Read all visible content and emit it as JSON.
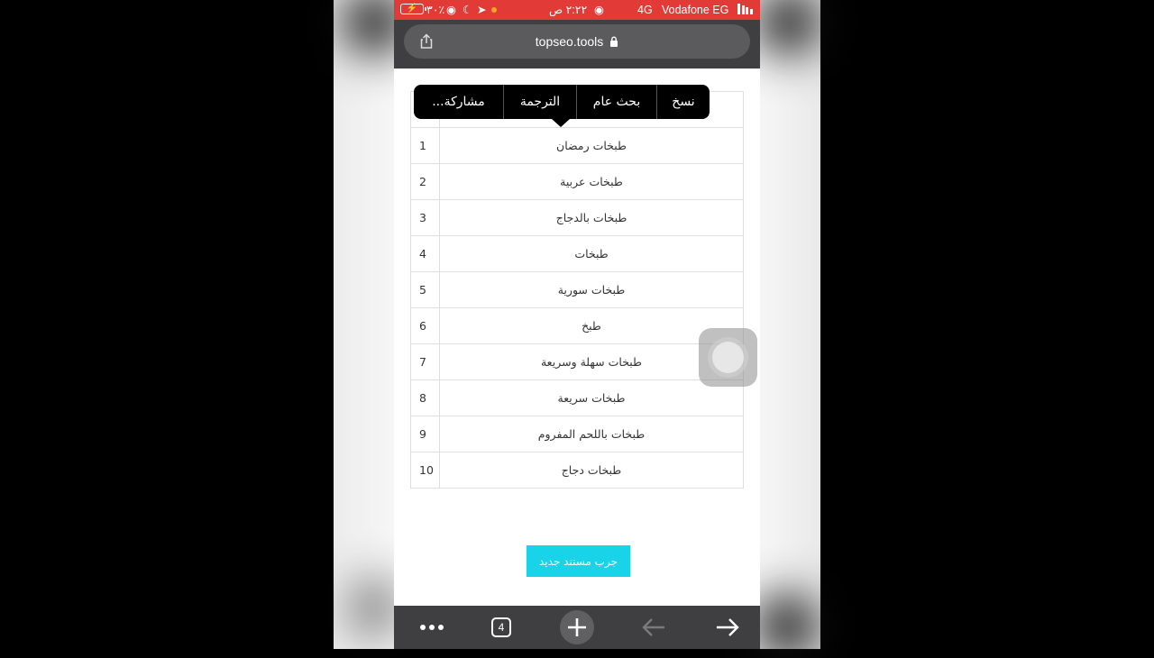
{
  "status_bar": {
    "carrier": "Vodafone EG",
    "network": "4G",
    "time": "٢:٢٢ ص",
    "battery": "٣٠٪"
  },
  "browser": {
    "url": "topseo.tools",
    "tab_count": "4"
  },
  "context_menu": {
    "items": [
      "نسخ",
      "بحث عام",
      "الترجمة",
      "مشاركة..."
    ]
  },
  "keywords_table": {
    "rows": [
      {
        "num": "1",
        "keyword": "طبخات رمضان"
      },
      {
        "num": "2",
        "keyword": "طبخات عربية"
      },
      {
        "num": "3",
        "keyword": "طبخات بالدجاج"
      },
      {
        "num": "4",
        "keyword": "طبخات"
      },
      {
        "num": "5",
        "keyword": "طبخات سورية"
      },
      {
        "num": "6",
        "keyword": "طبخ"
      },
      {
        "num": "7",
        "keyword": "طبخات سهلة وسريعة"
      },
      {
        "num": "8",
        "keyword": "طبخات سريعة"
      },
      {
        "num": "9",
        "keyword": "طبخات باللحم المفروم"
      },
      {
        "num": "10",
        "keyword": "طبخات دجاج"
      }
    ]
  },
  "try_button_label": "جرب مستند جديد",
  "colors": {
    "status_bar": "#e23b37",
    "browser_chrome": "#3f3f41",
    "button_accent": "#19d3e8"
  },
  "icons": [
    "share-icon",
    "lock-icon",
    "more-icon",
    "tabs-icon",
    "new-tab-icon",
    "back-icon",
    "forward-icon"
  ]
}
